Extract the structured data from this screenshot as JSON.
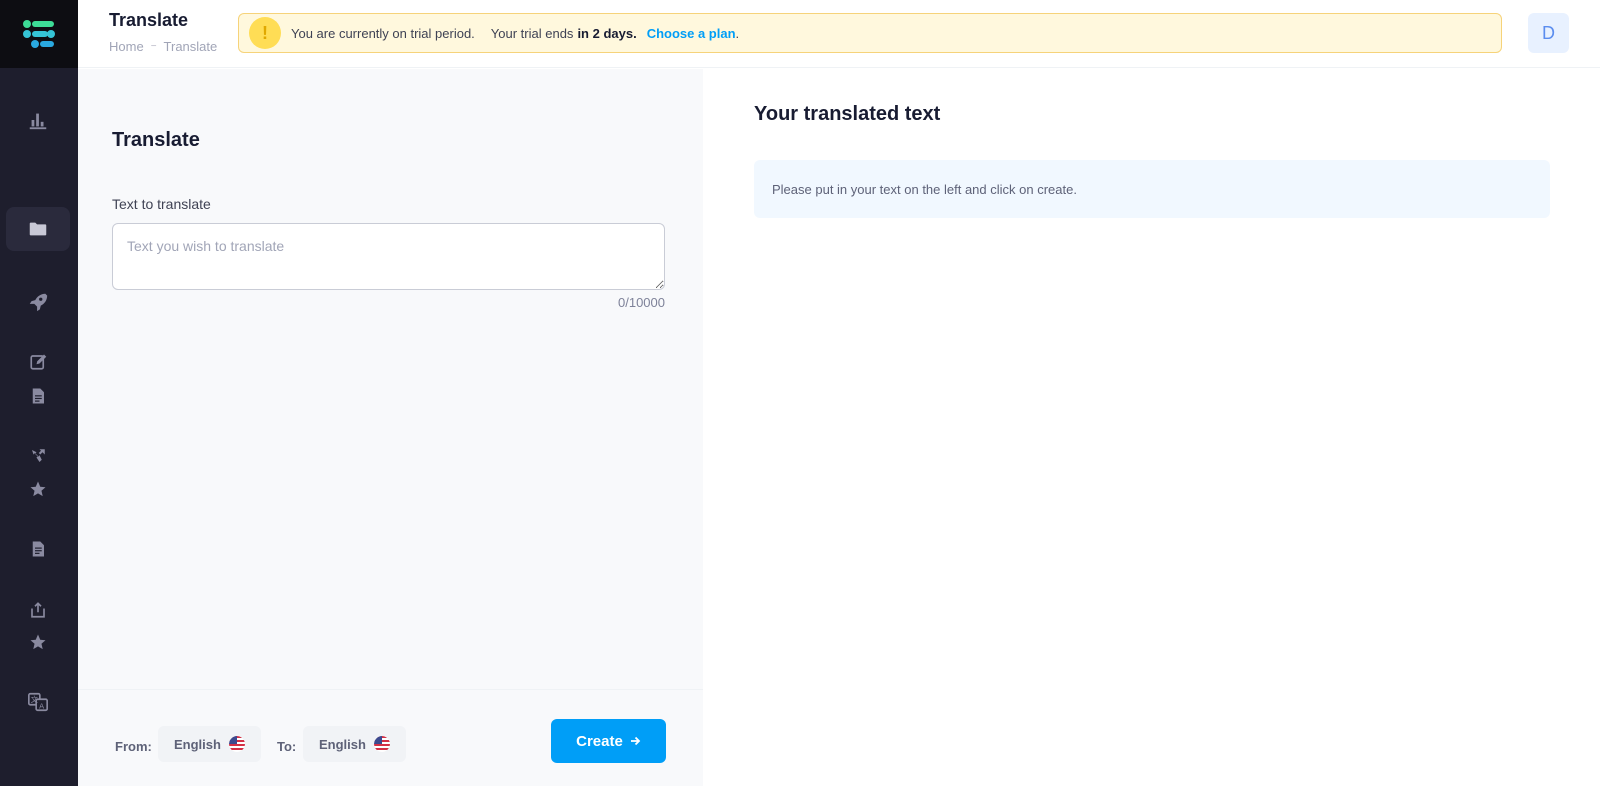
{
  "header": {
    "title": "Translate",
    "breadcrumb": [
      "Home",
      "Translate"
    ],
    "breadcrumb_sep": "−",
    "trial_banner": {
      "icon": "!",
      "text_1": "You are currently on trial period.",
      "text_2": "Your trial ends",
      "text_bold": "in 2 days.",
      "link": "Choose a plan",
      "suffix": "."
    },
    "avatar_initial": "D"
  },
  "sidebar": {
    "items": [
      {
        "icon": "bar-chart-icon"
      },
      {
        "icon": "folder-icon",
        "active": true
      },
      {
        "icon": "rocket-icon"
      },
      {
        "icon": "edit-icon"
      },
      {
        "icon": "document-icon"
      },
      {
        "icon": "rocket-alt-icon"
      },
      {
        "icon": "star-icon"
      },
      {
        "icon": "document-list-icon"
      },
      {
        "icon": "upload-icon"
      },
      {
        "icon": "star-icon"
      },
      {
        "icon": "translate-icon"
      }
    ]
  },
  "left": {
    "title": "Translate",
    "field_label": "Text to translate",
    "placeholder": "Text you wish to translate",
    "char_count": "0/10000",
    "from_label": "From:",
    "from_lang": "English",
    "to_label": "To:",
    "to_lang": "English",
    "create_label": "Create"
  },
  "right": {
    "title": "Your translated text",
    "empty_message": "Please put in your text on the left and click on create."
  },
  "colors": {
    "sidebar_bg": "#1e1e2d",
    "accent": "#009ef7",
    "banner_bg": "#fff8dd"
  }
}
